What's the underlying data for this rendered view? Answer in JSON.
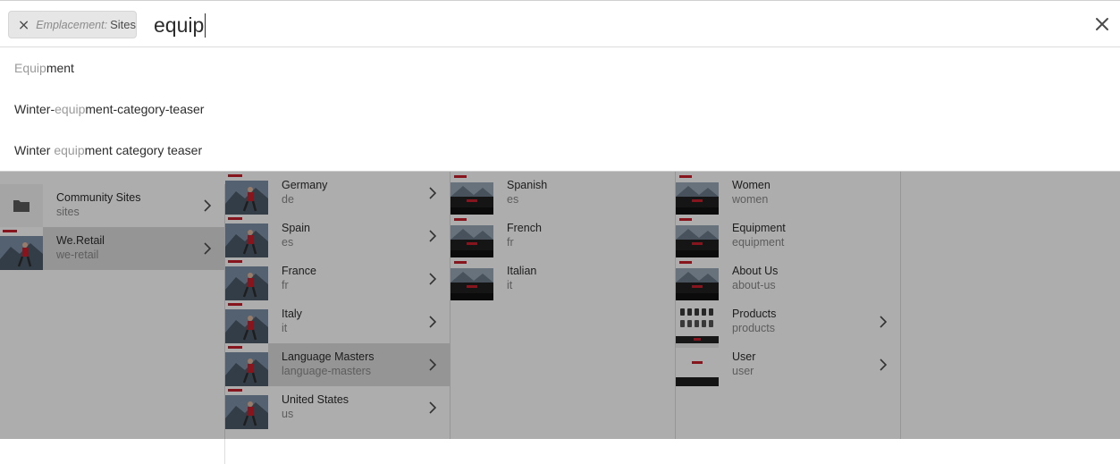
{
  "search": {
    "filter_tag": {
      "key": "Emplacement:",
      "value": "Sites"
    },
    "query": "equip"
  },
  "suggestions": [
    {
      "match": "Equip",
      "match_pos": "start",
      "before": "",
      "after": "ment"
    },
    {
      "match": "equip",
      "match_pos": "middle",
      "before": "Winter-",
      "after": "ment-category-teaser"
    },
    {
      "match": "equip",
      "match_pos": "middle",
      "before": "Winter ",
      "after": "ment category teaser"
    }
  ],
  "columns": [
    {
      "items": [
        {
          "title": "Community Sites",
          "name": "sites",
          "icon": "folder-icon",
          "has_children": true,
          "selected": false
        },
        {
          "title": "We.Retail",
          "name": "we-retail",
          "icon": "page-thumbnail",
          "has_children": true,
          "selected": true
        }
      ]
    },
    {
      "items": [
        {
          "title": "Germany",
          "name": "de",
          "icon": "page-thumbnail",
          "has_children": true,
          "selected": false
        },
        {
          "title": "Spain",
          "name": "es",
          "icon": "page-thumbnail",
          "has_children": true,
          "selected": false
        },
        {
          "title": "France",
          "name": "fr",
          "icon": "page-thumbnail",
          "has_children": true,
          "selected": false
        },
        {
          "title": "Italy",
          "name": "it",
          "icon": "page-thumbnail",
          "has_children": true,
          "selected": false
        },
        {
          "title": "Language Masters",
          "name": "language-masters",
          "icon": "page-thumbnail",
          "has_children": true,
          "selected": true
        },
        {
          "title": "United States",
          "name": "us",
          "icon": "page-thumbnail",
          "has_children": true,
          "selected": false
        }
      ]
    },
    {
      "items": [
        {
          "title": "Spanish",
          "name": "es",
          "icon": "page-thumbnail",
          "has_children": false,
          "selected": false
        },
        {
          "title": "French",
          "name": "fr",
          "icon": "page-thumbnail",
          "has_children": false,
          "selected": false
        },
        {
          "title": "Italian",
          "name": "it",
          "icon": "page-thumbnail",
          "has_children": false,
          "selected": false
        }
      ]
    },
    {
      "items": [
        {
          "title": "Women",
          "name": "women",
          "icon": "page-thumbnail",
          "has_children": false,
          "selected": false
        },
        {
          "title": "Equipment",
          "name": "equipment",
          "icon": "page-thumbnail",
          "has_children": false,
          "selected": false
        },
        {
          "title": "About Us",
          "name": "about-us",
          "icon": "page-thumbnail",
          "has_children": false,
          "selected": false
        },
        {
          "title": "Products",
          "name": "products",
          "icon": "page-thumbnail",
          "has_children": true,
          "selected": false
        },
        {
          "title": "User",
          "name": "user",
          "icon": "page-thumbnail",
          "has_children": true,
          "selected": false
        }
      ]
    }
  ],
  "colors": {
    "highlight_text": "#9a9a9a",
    "overlay": "#000000",
    "thumb_red": "#c8202c"
  }
}
